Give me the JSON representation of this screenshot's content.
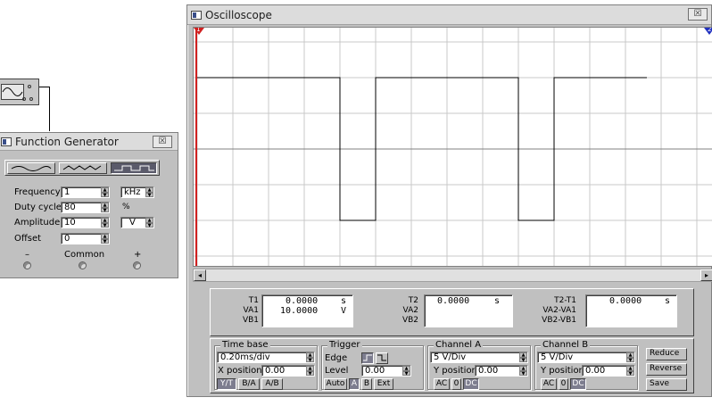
{
  "function_generator": {
    "title": "Function Generator",
    "close_symbol": "☒",
    "waveforms": [
      "sine-wave-icon",
      "triangle-wave-icon",
      "square-wave-icon"
    ],
    "selected_waveform": "square",
    "frequency": {
      "label": "Frequency",
      "value": "1",
      "unit": "kHz"
    },
    "duty_cycle": {
      "label": "Duty cycle",
      "value": "80",
      "unit": "%"
    },
    "amplitude": {
      "label": "Amplitude",
      "value": "10",
      "unit": "V"
    },
    "offset": {
      "label": "Offset",
      "value": "0"
    },
    "terminals": {
      "minus": "–",
      "common": "Common",
      "plus": "+"
    }
  },
  "oscilloscope": {
    "title": "Oscilloscope",
    "close_symbol": "☒",
    "cursor_1": "1",
    "cursor_2": "2",
    "readouts": {
      "t1": {
        "l1": "T1",
        "l2": "VA1",
        "l3": "VB1",
        "time": "0.0000",
        "time_unit": "s",
        "va": "10.0000",
        "va_unit": "V"
      },
      "t2": {
        "l1": "T2",
        "l2": "VA2",
        "l3": "VB2",
        "time": "0.0000",
        "time_unit": "s"
      },
      "diff": {
        "l1": "T2-T1",
        "l2": "VA2-VA1",
        "l3": "VB2-VB1",
        "time": "0.0000",
        "time_unit": "s"
      }
    },
    "timebase": {
      "label": "Time base",
      "value": "0.20ms/div",
      "xpos_label": "X position",
      "xpos": "0.00",
      "modes": [
        "Y/T",
        "B/A",
        "A/B"
      ],
      "active_mode": "Y/T"
    },
    "trigger": {
      "label": "Trigger",
      "edge_label": "Edge",
      "level_label": "Level",
      "level": "0.00",
      "modes": [
        "Auto",
        "A",
        "B",
        "Ext"
      ],
      "active_mode": "A"
    },
    "channel_a": {
      "label": "Channel A",
      "scale": "5 V/Div",
      "ypos_label": "Y position",
      "ypos": "0.00",
      "coupling": [
        "AC",
        "0",
        "DC"
      ],
      "active_coupling": "DC"
    },
    "channel_b": {
      "label": "Channel B",
      "scale": "5 V/Div",
      "ypos_label": "Y position",
      "ypos": "0.00",
      "coupling": [
        "AC",
        "0",
        "DC"
      ],
      "active_coupling": "DC"
    },
    "buttons": {
      "reduce": "Reduce",
      "reverse": "Reverse",
      "save": "Save"
    }
  },
  "chart_data": {
    "type": "line",
    "title": "",
    "xlabel": "",
    "ylabel": "",
    "grid": true,
    "x_divisions": 10,
    "y_divisions": 6,
    "series": [
      {
        "x": [
          0,
          4.0,
          4.0,
          5.0,
          5.0,
          9.0,
          9.0,
          10.0,
          10.0,
          12.6
        ],
        "y": [
          2,
          2,
          -2,
          -2,
          2,
          2,
          -2,
          -2,
          2,
          2
        ]
      }
    ],
    "ylim": [
      -3,
      3
    ],
    "xlim": [
      0,
      14.35
    ]
  }
}
